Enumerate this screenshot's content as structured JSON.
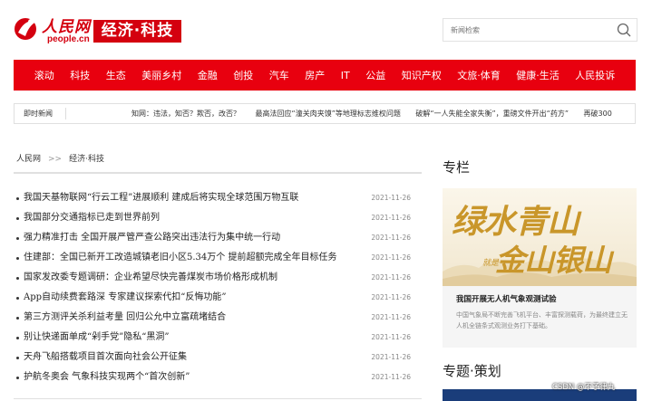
{
  "header": {
    "logo_text": "人民网",
    "logo_domain": "people.cn",
    "channel_name": "经济·科技"
  },
  "search": {
    "placeholder": "新闻检索",
    "icon": "search-icon"
  },
  "nav": {
    "items": [
      "滚动",
      "科技",
      "生态",
      "美丽乡村",
      "金融",
      "创投",
      "汽车",
      "房产",
      "IT",
      "公益",
      "知识产权",
      "文旅·体育",
      "健康·生活",
      "人民投诉"
    ],
    "background": "#e8000f"
  },
  "ticker": {
    "label": "即时新闻",
    "items": [
      "知网：违法，知否？欺否，改否？",
      "最高法回应“潼关肉夹馍”等地理标志维权问题",
      "破解“一人失能全家失衡”，重磅文件开出“药方”",
      "再破300"
    ]
  },
  "breadcrumb": {
    "home": "人民网",
    "separator": ">>",
    "current": "经济·科技"
  },
  "news": [
    {
      "title": "我国天基物联网“行云工程”进展顺利 建成后将实现全球范围万物互联",
      "date": "2021-11-26"
    },
    {
      "title": "我国部分交通指标已走到世界前列",
      "date": "2021-11-26"
    },
    {
      "title": "强力精准打击 全国开展严管严查公路突出违法行为集中统一行动",
      "date": "2021-11-26"
    },
    {
      "title": "住建部：全国已新开工改造城镇老旧小区5.34万个 提前超额完成全年目标任务",
      "date": "2021-11-26"
    },
    {
      "title": "国家发改委专题调研：企业希望尽快完善煤炭市场价格形成机制",
      "date": "2021-11-26"
    },
    {
      "title": "App自动续费套路深 专家建议探索代扣“反悔功能”",
      "date": "2021-11-26"
    },
    {
      "title": "第三方测评关杀利益考量 回归公允中立富疏堵结合",
      "date": "2021-11-26"
    },
    {
      "title": "别让快递面单成“剁手党”隐私“黑洞”",
      "date": "2021-11-26"
    },
    {
      "title": "天舟飞船搭载项目首次面向社会公开征集",
      "date": "2021-11-26"
    },
    {
      "title": "护航冬奥会 气象科技实现两个“首次创新”",
      "date": "2021-11-26"
    }
  ],
  "sidebar": {
    "column_title": "专栏",
    "feature": {
      "image_text_line1": "绿水青山",
      "image_text_jiu": "就是",
      "image_text_line2": "金山银山",
      "title": "我国开展无人机气象观测试验",
      "desc": "中国气象局不断完善飞机平台、丰富探测载荷，为最终建立无人机全链条式观测业务打下基础。"
    },
    "topics_title": "专题·策划"
  },
  "watermark": "CSDN @不予律九"
}
